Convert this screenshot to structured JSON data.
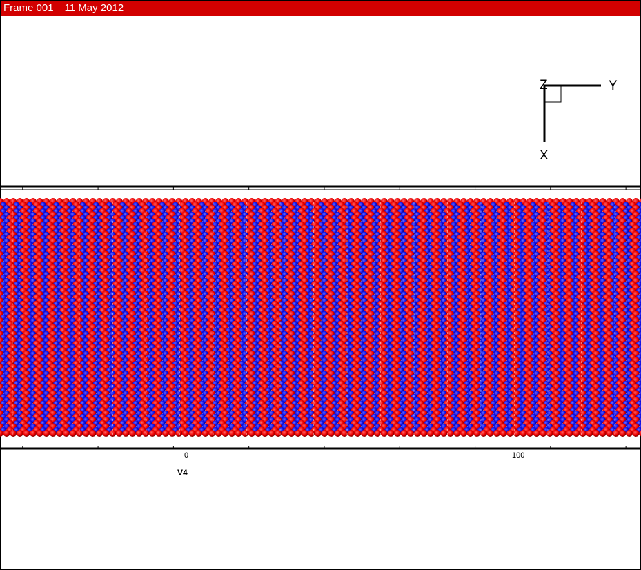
{
  "header": {
    "frame_label": "Frame 001",
    "date_label": "11 May 2012",
    "background": "#d20000"
  },
  "axes_triad": {
    "horizontal_axis": "Y",
    "vertical_axis": "X",
    "out_of_plane_axis": "Z"
  },
  "plot": {
    "x_axis_title": "V4",
    "tick_labels": [
      {
        "value": 0,
        "label": "0"
      },
      {
        "value": 100,
        "label": "100"
      }
    ],
    "x_range": [
      -56,
      114
    ],
    "atom_colors": {
      "type_a": "#ff0000",
      "type_b": "#1010ff"
    }
  }
}
